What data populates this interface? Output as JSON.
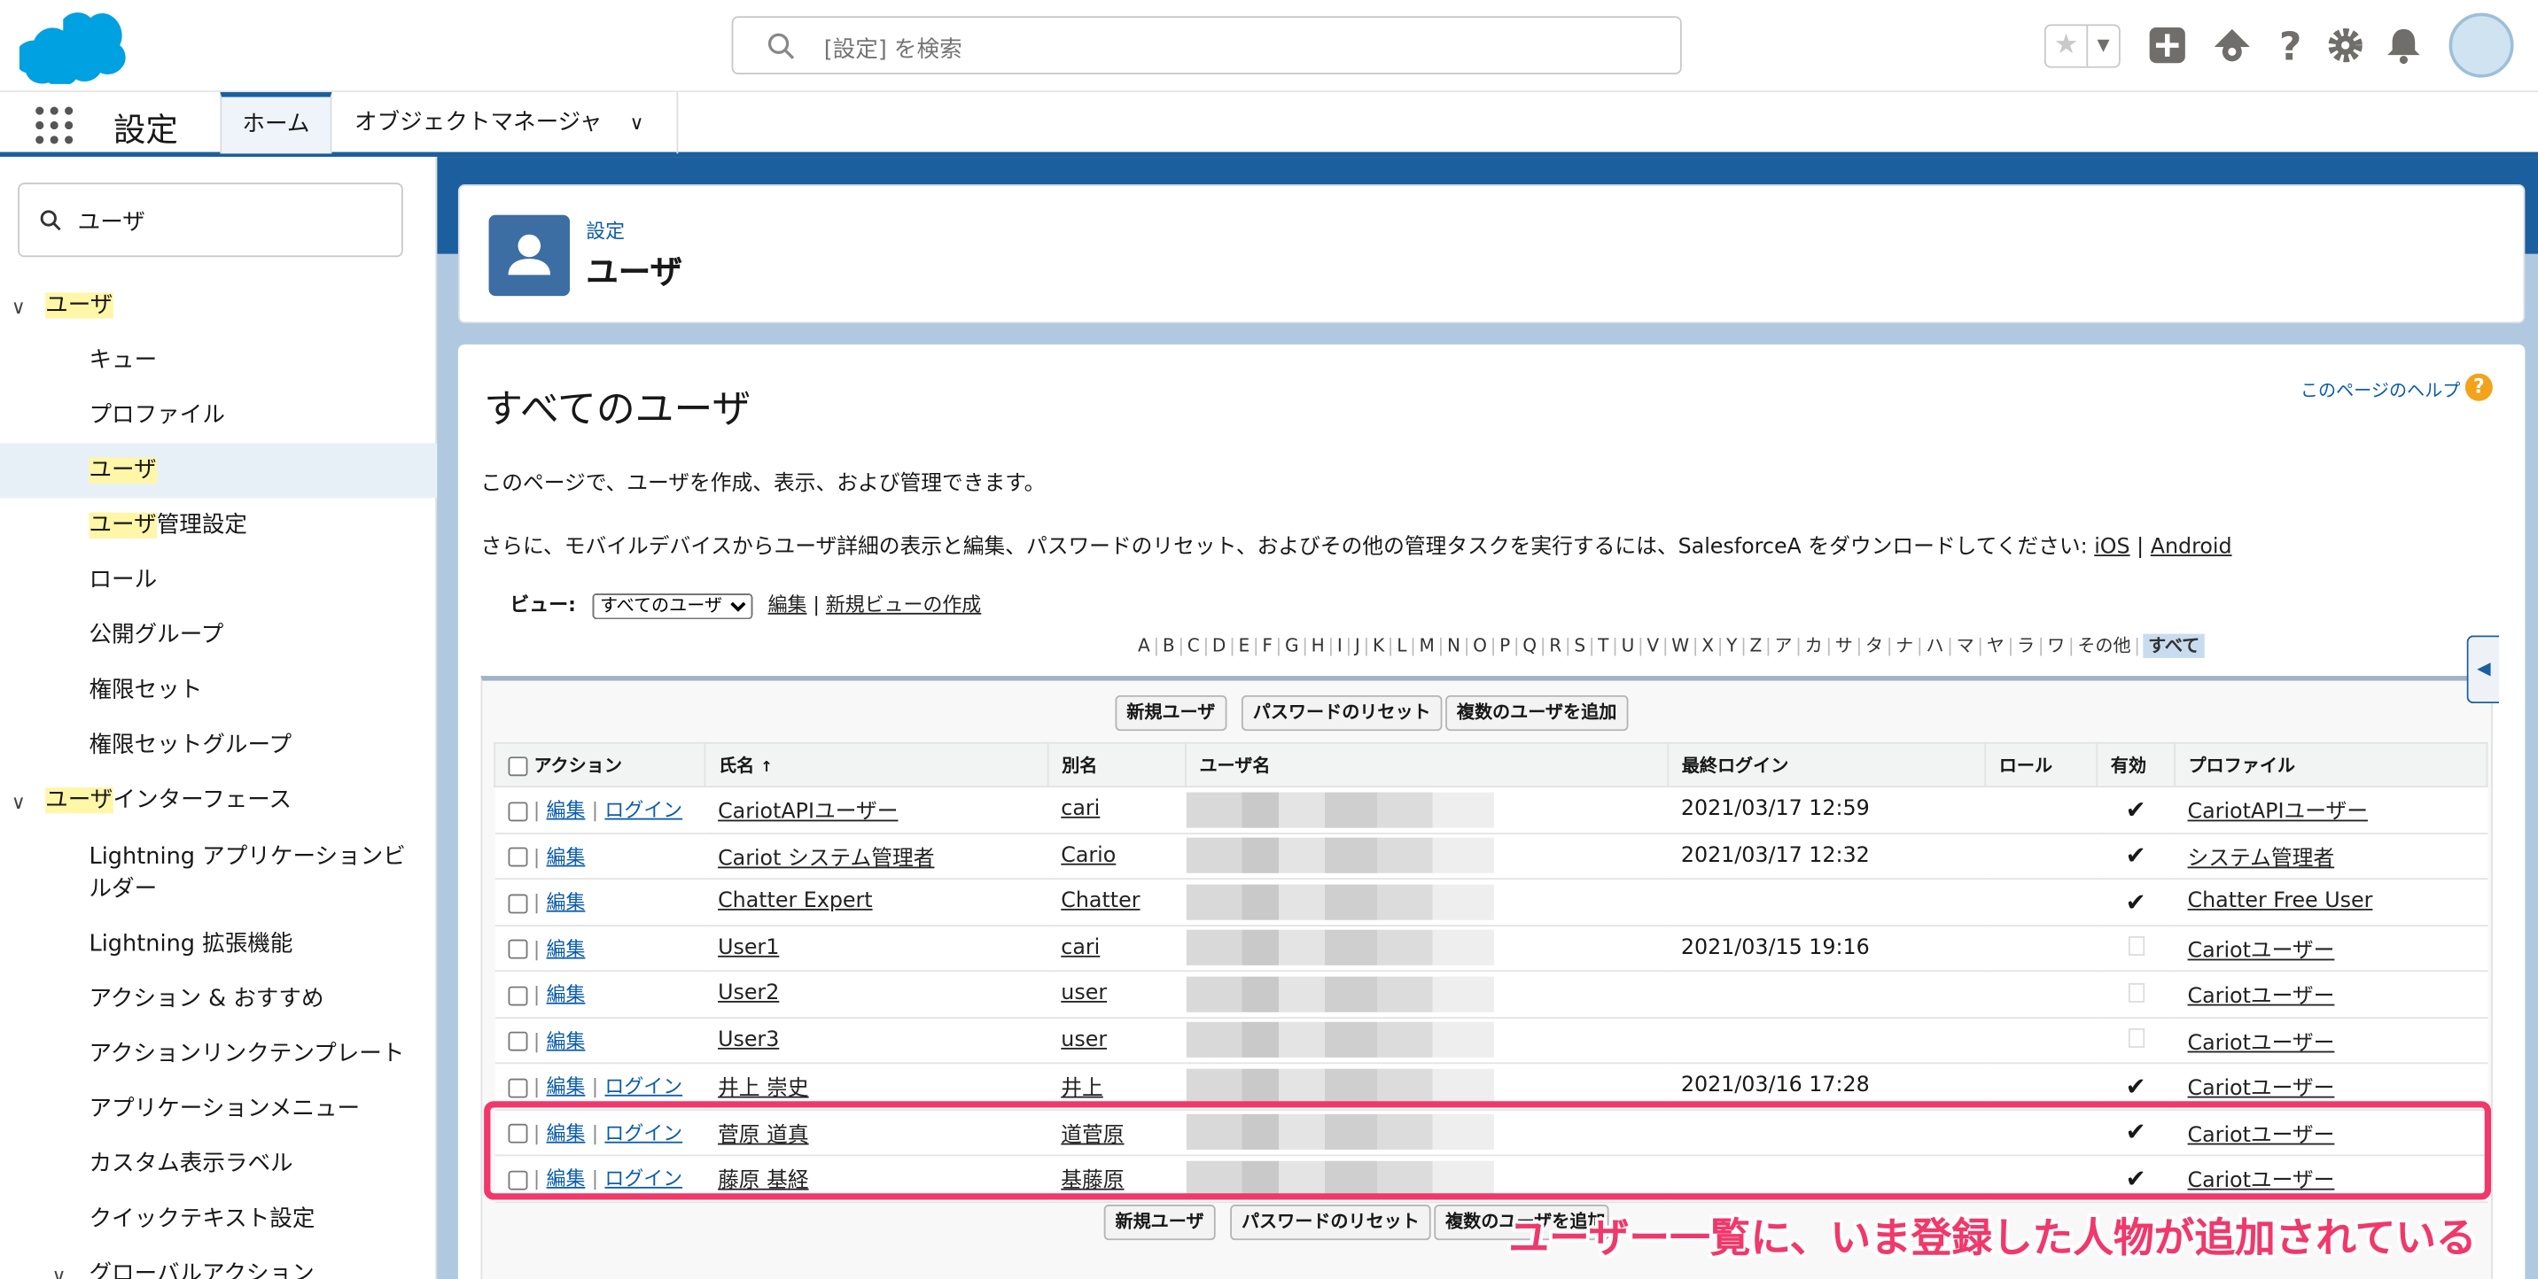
{
  "search": {
    "placeholder": "[設定] を検索"
  },
  "nav": {
    "app_title": "設定",
    "tabs": [
      {
        "label": "ホーム"
      },
      {
        "label": "オブジェクトマネージャ"
      }
    ]
  },
  "sidebar": {
    "quickfind_value": "ユーザ",
    "items": [
      {
        "label_hl": "ユーザ",
        "label_rest": "",
        "toggle": "∨"
      },
      {
        "label": "キュー"
      },
      {
        "label": "プロファイル"
      },
      {
        "label_hl": "ユーザ",
        "label_rest": ""
      },
      {
        "label_hl": "ユーザ",
        "label_rest": "管理設定"
      },
      {
        "label": "ロール"
      },
      {
        "label": "公開グループ"
      },
      {
        "label": "権限セット"
      },
      {
        "label": "権限セットグループ"
      },
      {
        "label_hl": "ユーザ",
        "label_rest": "インターフェース",
        "toggle": "∨"
      },
      {
        "label": "Lightning アプリケーションビルダー"
      },
      {
        "label": "Lightning 拡張機能"
      },
      {
        "label": "アクション & おすすめ"
      },
      {
        "label": "アクションリンクテンプレート"
      },
      {
        "label": "アプリケーションメニュー"
      },
      {
        "label": "カスタム表示ラベル"
      },
      {
        "label": "クイックテキスト設定"
      },
      {
        "label": "グローバルアクション",
        "toggle": "∨"
      }
    ]
  },
  "header": {
    "breadcrumb": "設定",
    "title": "ユーザ"
  },
  "content": {
    "title": "すべてのユーザ",
    "help_link": "このページのヘルプ",
    "help_icon": "?",
    "desc1": "このページで、ユーザを作成、表示、および管理できます。",
    "desc2": "さらに、モバイルデバイスからユーザ詳細の表示と編集、パスワードのリセット、およびその他の管理タスクを実行するには、SalesforceA をダウンロードしてください:",
    "ios": "iOS",
    "pipe": "|",
    "android": "Android",
    "view_label": "ビュー:",
    "view_selected": "すべてのユーザ",
    "view_edit": "編集",
    "view_new": "新規ビューの作成",
    "alphabet": [
      "A",
      "B",
      "C",
      "D",
      "E",
      "F",
      "G",
      "H",
      "I",
      "J",
      "K",
      "L",
      "M",
      "N",
      "O",
      "P",
      "Q",
      "R",
      "S",
      "T",
      "U",
      "V",
      "W",
      "X",
      "Y",
      "Z",
      "ア",
      "カ",
      "サ",
      "タ",
      "ナ",
      "ハ",
      "マ",
      "ヤ",
      "ラ",
      "ワ",
      "その他",
      "すべて"
    ],
    "buttons": {
      "new_user": "新規ユーザ",
      "reset_pw": "パスワードのリセット",
      "add_multi": "複数のユーザを追加"
    }
  },
  "table": {
    "headers": {
      "action": "アクション",
      "name": "氏名",
      "sort": "↑",
      "alias": "別名",
      "username": "ユーザ名",
      "last_login": "最終ログイン",
      "role": "ロール",
      "active": "有効",
      "profile": "プロファイル"
    },
    "edit": "編集",
    "login": "ログイン",
    "rows": [
      {
        "name": "CariotAPIユーザー",
        "alias": "cari",
        "last_login": "2021/03/17 12:59",
        "active": true,
        "profile": "CariotAPIユーザー",
        "has_login": true
      },
      {
        "name": "Cariot システム管理者",
        "alias": "Cario",
        "last_login": "2021/03/17 12:32",
        "active": true,
        "profile": "システム管理者",
        "has_login": false
      },
      {
        "name": "Chatter Expert",
        "alias": "Chatter",
        "last_login": "",
        "active": true,
        "profile": "Chatter Free User",
        "has_login": false
      },
      {
        "name": "User1",
        "alias": "cari",
        "last_login": "2021/03/15 19:16",
        "active": false,
        "profile": "Cariotユーザー",
        "has_login": false
      },
      {
        "name": "User2",
        "alias": "user",
        "last_login": "",
        "active": false,
        "profile": "Cariotユーザー",
        "has_login": false
      },
      {
        "name": "User3",
        "alias": "user",
        "last_login": "",
        "active": false,
        "profile": "Cariotユーザー",
        "has_login": false
      },
      {
        "name": "井上 崇史",
        "alias": "井上",
        "last_login": "2021/03/16 17:28",
        "active": true,
        "profile": "Cariotユーザー",
        "has_login": true
      },
      {
        "name": "菅原 道真",
        "alias": "道菅原",
        "last_login": "",
        "active": true,
        "profile": "Cariotユーザー",
        "has_login": true
      },
      {
        "name": "藤原 基経",
        "alias": "基藤原",
        "last_login": "",
        "active": true,
        "profile": "Cariotユーザー",
        "has_login": true
      }
    ]
  },
  "annotation": "ユーザー一覧に、いま登録した人物が追加されている",
  "colors": {
    "brand": "#1b5f9e",
    "annotation": "#f0386b",
    "highlight": "#fff6a8"
  }
}
